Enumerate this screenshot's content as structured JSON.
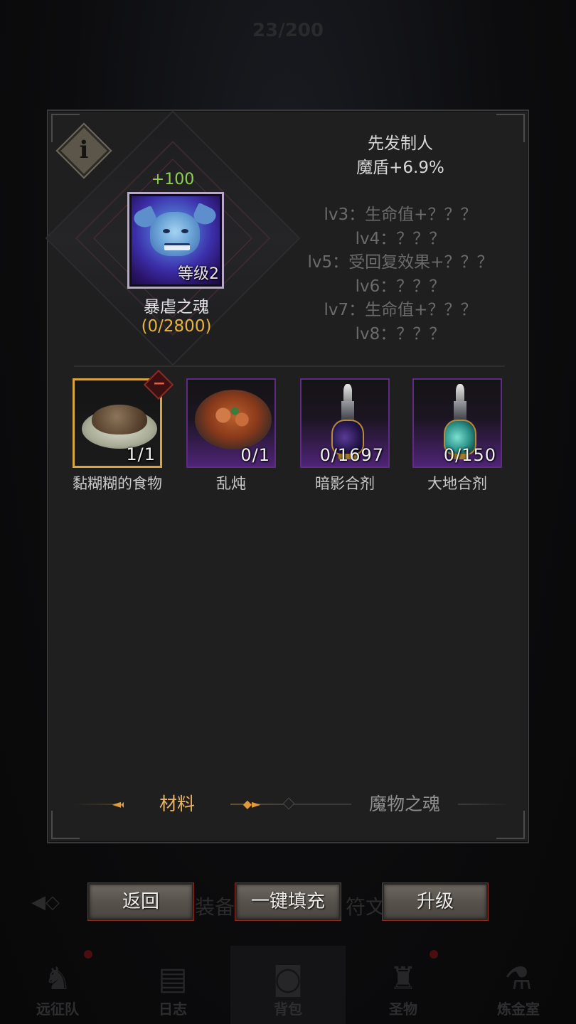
{
  "background": {
    "capacity": "23/200",
    "tabs": [
      "装备",
      "符文"
    ],
    "nav": [
      {
        "label": "远征队",
        "icon": "helmet-icon"
      },
      {
        "label": "日志",
        "icon": "scroll-icon"
      },
      {
        "label": "背包",
        "icon": "bag-icon",
        "active": true
      },
      {
        "label": "圣物",
        "icon": "relic-icon"
      },
      {
        "label": "炼金室",
        "icon": "alchemy-icon"
      }
    ]
  },
  "soul": {
    "exp_gain": "+100",
    "level_label": "等级2",
    "name": "暴虐之魂",
    "progress": "(0/2800)",
    "title": "先发制人",
    "bonus": "魔盾+6.9%",
    "levels": [
      "lv3：生命值+？？？",
      "lv4：？？？",
      "lv5：受回复效果+？？？",
      "lv6：？？？",
      "lv7：生命值+？？？",
      "lv8：？？？"
    ]
  },
  "items": [
    {
      "name": "黏糊糊的食物",
      "count": "1/1",
      "selected": true,
      "icon": "mush-food-icon"
    },
    {
      "name": "乱炖",
      "count": "0/1",
      "selected": false,
      "icon": "stew-bowl-icon"
    },
    {
      "name": "暗影合剂",
      "count": "0/1697",
      "selected": false,
      "icon": "shadow-potion-icon"
    },
    {
      "name": "大地合剂",
      "count": "0/150",
      "selected": false,
      "icon": "earth-potion-icon"
    }
  ],
  "tabs": {
    "materials": "材料",
    "monster_souls": "魔物之魂"
  },
  "buttons": {
    "back": "返回",
    "auto_fill": "一键填充",
    "upgrade": "升级"
  },
  "colors": {
    "exp_green": "#8ed04c",
    "progress_gold": "#e8b53a",
    "active_tab": "#e8b468",
    "selected_border": "#d8a53c",
    "rare_purple": "#5e2a85"
  }
}
